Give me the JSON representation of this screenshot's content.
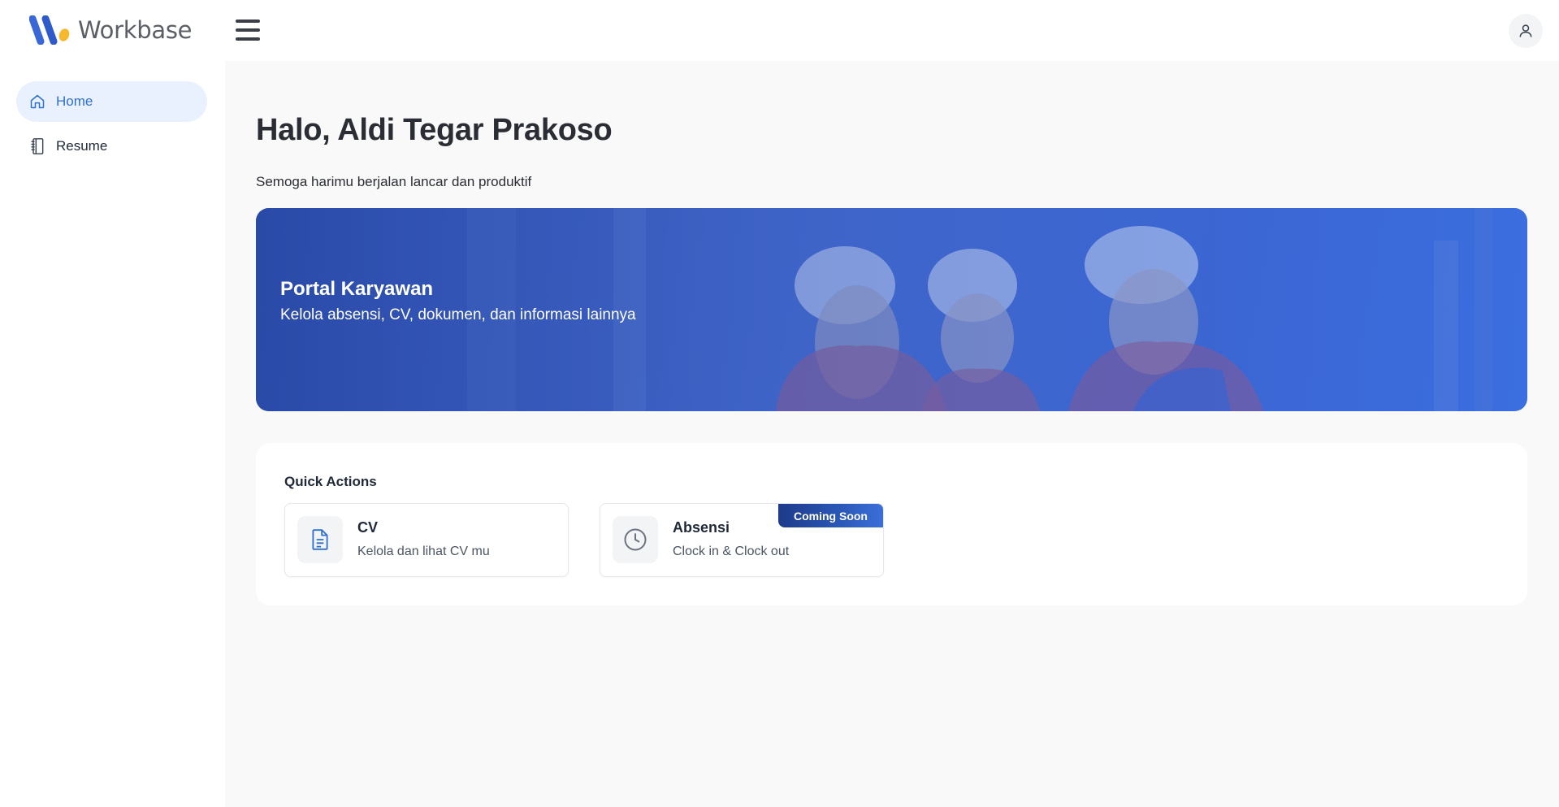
{
  "app": {
    "name": "Workbase"
  },
  "sidebar": {
    "items": [
      {
        "label": "Home",
        "icon": "home-icon",
        "active": true
      },
      {
        "label": "Resume",
        "icon": "notebook-icon",
        "active": false
      }
    ]
  },
  "main": {
    "greeting": "Halo, Aldi Tegar Prakoso",
    "subgreeting": "Semoga harimu berjalan lancar dan produktif",
    "hero": {
      "title": "Portal Karyawan",
      "subtitle": "Kelola absensi, CV, dokumen, dan informasi lainnya"
    },
    "quick_actions": {
      "title": "Quick Actions",
      "items": [
        {
          "title": "CV",
          "description": "Kelola dan lihat CV mu",
          "icon": "document-icon",
          "badge": ""
        },
        {
          "title": "Absensi",
          "description": "Clock in & Clock out",
          "icon": "clock-icon",
          "badge": "Coming Soon"
        }
      ]
    }
  },
  "colors": {
    "accent": "#2f6fd1",
    "active_nav_bg": "#e8f1fd",
    "hero_blue": "#3a63cf",
    "badge_dark": "#1e3a8a"
  }
}
